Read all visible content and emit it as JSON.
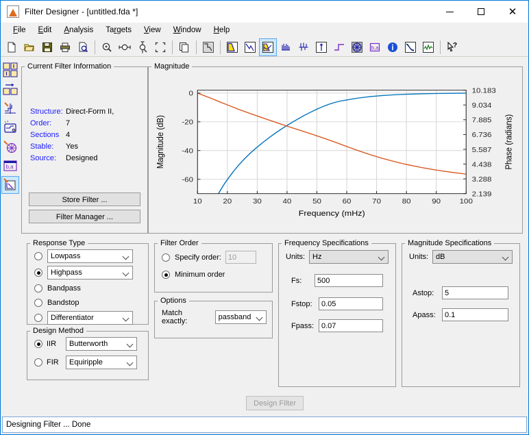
{
  "window": {
    "title": "Filter Designer -  [untitled.fda *]",
    "icon": "filter-designer-icon",
    "minimize_label": "–",
    "maximize_label": "☐",
    "close_label": "✕"
  },
  "menubar": {
    "items": [
      {
        "label": "File",
        "accel": "F"
      },
      {
        "label": "Edit",
        "accel": "E"
      },
      {
        "label": "Analysis",
        "accel": "A"
      },
      {
        "label": "Targets",
        "accel": "T"
      },
      {
        "label": "View",
        "accel": "V"
      },
      {
        "label": "Window",
        "accel": "W"
      },
      {
        "label": "Help",
        "accel": "H"
      }
    ]
  },
  "toolbar": {
    "items": [
      {
        "name": "new-icon",
        "title": "New"
      },
      {
        "name": "open-icon",
        "title": "Open"
      },
      {
        "name": "save-icon",
        "title": "Save"
      },
      {
        "name": "print-icon",
        "title": "Print"
      },
      {
        "name": "print-preview-icon",
        "title": "Print Preview"
      },
      {
        "name": "sep",
        "title": ""
      },
      {
        "name": "zoom-in-icon",
        "title": "Zoom In"
      },
      {
        "name": "zoom-x-icon",
        "title": "Zoom X"
      },
      {
        "name": "zoom-y-icon",
        "title": "Zoom Y"
      },
      {
        "name": "full-view-icon",
        "title": "Full View"
      },
      {
        "name": "sep",
        "title": ""
      },
      {
        "name": "copy-figure-icon",
        "title": "Copy Figure"
      },
      {
        "name": "sep",
        "title": ""
      },
      {
        "name": "filter-spec-icon",
        "title": "Filter Specifications"
      },
      {
        "name": "sep",
        "title": ""
      },
      {
        "name": "magnitude-response-icon",
        "title": "Magnitude Response"
      },
      {
        "name": "phase-response-icon",
        "title": "Phase Response"
      },
      {
        "name": "magnitude-phase-icon",
        "title": "Magnitude and Phase Response",
        "active": true
      },
      {
        "name": "group-delay-icon",
        "title": "Group Delay Response"
      },
      {
        "name": "phase-delay-icon",
        "title": "Phase Delay"
      },
      {
        "name": "impulse-response-icon",
        "title": "Impulse Response"
      },
      {
        "name": "step-response-icon",
        "title": "Step Response"
      },
      {
        "name": "pole-zero-icon",
        "title": "Pole/Zero Plot"
      },
      {
        "name": "filter-coefficients-icon",
        "title": "Filter Coefficients"
      },
      {
        "name": "filter-information-icon",
        "title": "Filter Information"
      },
      {
        "name": "magnitude-estimate-icon",
        "title": "Magnitude Response Estimate"
      },
      {
        "name": "round-noise-icon",
        "title": "Round-off Noise Power Spectrum"
      },
      {
        "name": "sep",
        "title": ""
      },
      {
        "name": "help-pointer-icon",
        "title": "What's This?"
      }
    ]
  },
  "sidebar": {
    "items": [
      {
        "name": "design-filter-icon",
        "title": "Design Filter"
      },
      {
        "name": "import-filter-icon",
        "title": "Import Filter"
      },
      {
        "name": "quantize-filter-icon",
        "title": "Set Quantization Parameters"
      },
      {
        "name": "transform-filter-icon",
        "title": "Transform Filter"
      },
      {
        "name": "multirate-filter-icon",
        "title": "Create a Multirate Filter"
      },
      {
        "name": "realize-model-icon",
        "title": "Realize Model"
      },
      {
        "name": "pole-zero-editor-icon",
        "title": "Pole/Zero Editor",
        "active": true
      }
    ]
  },
  "current_filter_info": {
    "legend": "Current Filter Information",
    "rows": [
      {
        "key": "Structure:",
        "value": "Direct-Form II,"
      },
      {
        "key": "Order:",
        "value": "7"
      },
      {
        "key": "Sections",
        "value": "4"
      },
      {
        "key": "Stable:",
        "value": "Yes"
      },
      {
        "key": "Source:",
        "value": "Designed"
      }
    ],
    "store_filter_label": "Store Filter ...",
    "filter_manager_label": "Filter Manager ..."
  },
  "magnitude_panel": {
    "legend": "Magnitude"
  },
  "response_type": {
    "legend": "Response Type",
    "options": [
      {
        "label": "Lowpass",
        "selected": false,
        "is_dropdown": true
      },
      {
        "label": "Highpass",
        "selected": true,
        "is_dropdown": true
      },
      {
        "label": "Bandpass",
        "selected": false,
        "is_dropdown": false
      },
      {
        "label": "Bandstop",
        "selected": false,
        "is_dropdown": false
      },
      {
        "label": "Differentiator",
        "selected": false,
        "is_dropdown": true
      }
    ]
  },
  "design_method": {
    "legend": "Design Method",
    "iir": {
      "label": "IIR",
      "selected": true,
      "value": "Butterworth"
    },
    "fir": {
      "label": "FIR",
      "selected": false,
      "value": "Equiripple"
    }
  },
  "filter_order": {
    "legend": "Filter Order",
    "specify_label": "Specify order:",
    "specify_selected": false,
    "specify_value": "10",
    "minimum_label": "Minimum order",
    "minimum_selected": true
  },
  "options": {
    "legend": "Options",
    "match_label": "Match exactly:",
    "match_value": "passband"
  },
  "frequency_specs": {
    "legend": "Frequency Specifications",
    "units_label": "Units:",
    "units_value": "Hz",
    "fields": [
      {
        "label": "Fs:",
        "value": "500"
      },
      {
        "label": "Fstop:",
        "value": "0.05"
      },
      {
        "label": "Fpass:",
        "value": "0.07"
      }
    ]
  },
  "magnitude_specs": {
    "legend": "Magnitude Specifications",
    "units_label": "Units:",
    "units_value": "dB",
    "fields": [
      {
        "label": "Astop:",
        "value": "5"
      },
      {
        "label": "Apass:",
        "value": "0.1"
      }
    ]
  },
  "design_filter_button": {
    "label": "Design Filter",
    "enabled": false
  },
  "statusbar": {
    "text": "Designing Filter ... Done"
  },
  "chart_data": {
    "type": "line",
    "title": "",
    "xlabel": "Frequency (mHz)",
    "ylabel": "Magnitude (dB)",
    "y2label": "Phase (radians)",
    "xlim": [
      10,
      100
    ],
    "xticks": [
      10,
      20,
      30,
      40,
      50,
      60,
      70,
      80,
      90,
      100
    ],
    "ylim": [
      -70,
      2
    ],
    "yticks": [
      0,
      -20,
      -40,
      -60
    ],
    "ytick_labels": [
      "0",
      "-20",
      "-40",
      "-60"
    ],
    "y2ticks": [
      10.183,
      9.034,
      7.885,
      6.736,
      5.587,
      4.438,
      3.288,
      2.139
    ],
    "y2tick_labels": [
      "10.183",
      "9.034",
      "7.885",
      "6.736",
      "5.587",
      "4.438",
      "3.288",
      "2.139"
    ],
    "grid": true,
    "legend_position": "none",
    "series": [
      {
        "name": "Magnitude",
        "color": "#0072BD",
        "axis": "left",
        "x": [
          17.0,
          18.0,
          19.0,
          20.0,
          22.0,
          24.0,
          26.0,
          28.0,
          30.0,
          32.0,
          34.0,
          36.0,
          38.0,
          40.0,
          42.0,
          44.0,
          46.0,
          48.0,
          50.0,
          52.0,
          54.0,
          56.0,
          58.0,
          60.0,
          64.0,
          68.0,
          72.0,
          76.0,
          80.0,
          85.0,
          90.0,
          95.0,
          100.0
        ],
        "y": [
          -70.0,
          -66.5,
          -63.2,
          -60.2,
          -54.6,
          -49.6,
          -45.2,
          -41.2,
          -37.6,
          -34.2,
          -31.0,
          -28.0,
          -25.2,
          -22.5,
          -20.0,
          -17.6,
          -15.3,
          -13.2,
          -11.2,
          -9.4,
          -7.8,
          -6.5,
          -5.5,
          -4.8,
          -3.4,
          -2.4,
          -1.7,
          -1.2,
          -0.8,
          -0.5,
          -0.3,
          -0.15,
          -0.05
        ]
      },
      {
        "name": "Phase",
        "color": "#D95319",
        "axis": "right",
        "x": [
          10.0,
          12.0,
          14.0,
          16.0,
          18.0,
          20.0,
          24.0,
          28.0,
          32.0,
          36.0,
          40.0,
          44.0,
          48.0,
          52.0,
          56.0,
          60.0,
          64.0,
          68.0,
          72.0,
          76.0,
          80.0,
          85.0,
          90.0,
          95.0,
          100.0
        ],
        "y": [
          0.0,
          -1.6,
          -3.2,
          -4.9,
          -6.6,
          -8.2,
          -11.5,
          -14.5,
          -17.4,
          -20.2,
          -23.0,
          -25.7,
          -28.4,
          -31.2,
          -34.1,
          -37.2,
          -40.2,
          -43.0,
          -45.5,
          -47.7,
          -49.7,
          -51.8,
          -53.6,
          -55.1,
          -56.4
        ]
      }
    ]
  }
}
